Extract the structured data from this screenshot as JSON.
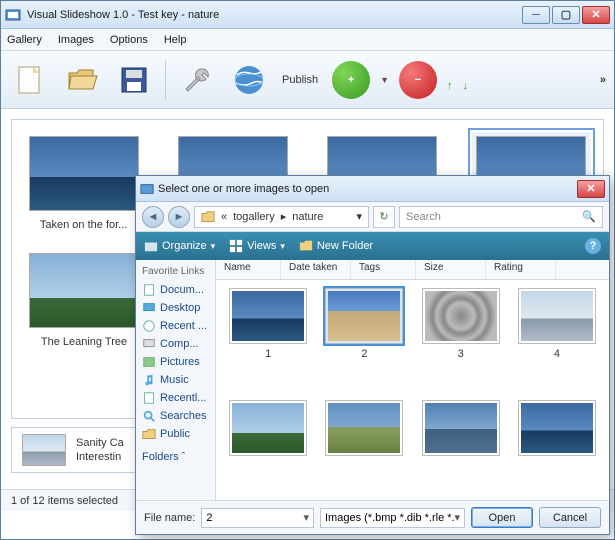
{
  "window": {
    "title": "Visual Slideshow 1.0 - Test key - nature"
  },
  "menu": {
    "gallery": "Gallery",
    "images": "Images",
    "options": "Options",
    "help": "Help"
  },
  "toolbar": {
    "publish": "Publish"
  },
  "gallery": {
    "thumbs": [
      {
        "caption": "Taken on the for..."
      },
      {
        "caption": ""
      },
      {
        "caption": ""
      },
      {
        "caption": ""
      }
    ],
    "row2": [
      {
        "caption": "The Leaning Tree"
      }
    ],
    "detail": {
      "line1": "Sanity Ca",
      "line2": "Interestin"
    }
  },
  "status": {
    "text": "1 of 12 items selected"
  },
  "dialog": {
    "title": "Select one or more images to open",
    "breadcrumb": {
      "seg1": "togallery",
      "seg2": "nature"
    },
    "search_placeholder": "Search",
    "toolbar": {
      "organize": "Organize",
      "views": "Views",
      "newfolder": "New Folder"
    },
    "sidebar": {
      "header": "Favorite Links",
      "items": [
        "Docum...",
        "Desktop",
        "Recent ...",
        "Comp...",
        "Pictures",
        "Music",
        "Recentl...",
        "Searches",
        "Public"
      ],
      "folders": "Folders"
    },
    "columns": {
      "name": "Name",
      "date": "Date taken",
      "tags": "Tags",
      "size": "Size",
      "rating": "Rating"
    },
    "files": [
      {
        "label": "1"
      },
      {
        "label": "2",
        "selected": true
      },
      {
        "label": "3"
      },
      {
        "label": "4"
      },
      {
        "label": ""
      },
      {
        "label": ""
      },
      {
        "label": ""
      },
      {
        "label": ""
      }
    ],
    "footer": {
      "filename_label": "File name:",
      "filename_value": "2",
      "filter": "Images (*.bmp *.dib *.rle *.jpg *",
      "open": "Open",
      "cancel": "Cancel"
    }
  }
}
